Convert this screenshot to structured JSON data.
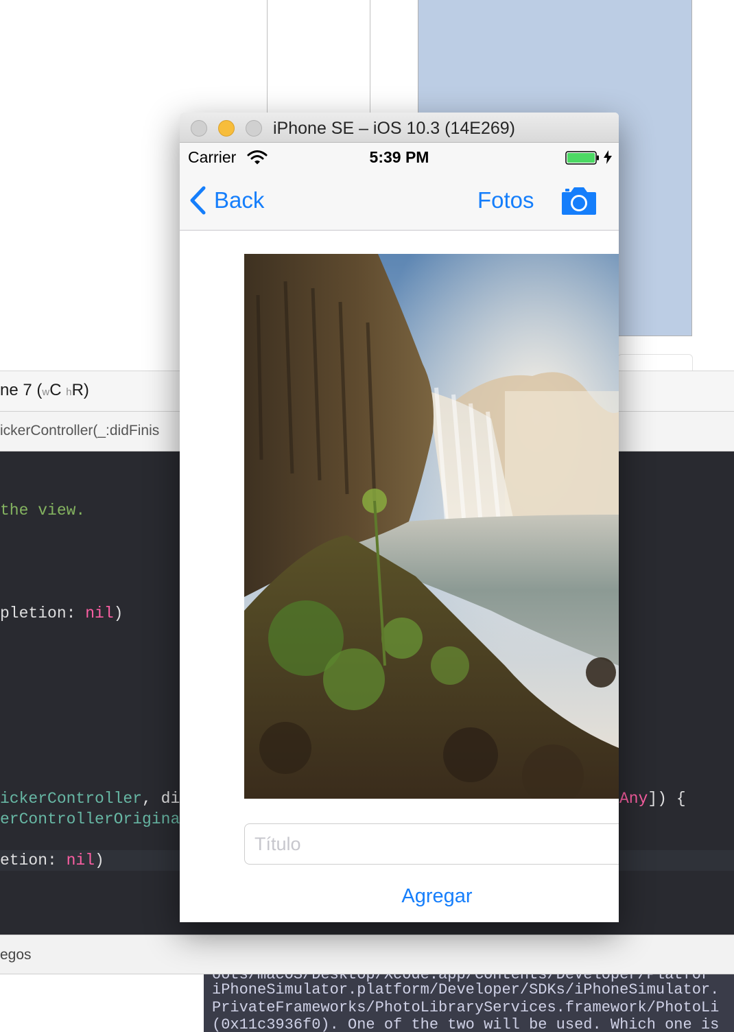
{
  "xcode": {
    "device_label": "ne 7 (",
    "device_size_w": "w",
    "device_size_c": "C",
    "device_size_h": "h",
    "device_size_r": "R)",
    "jump_bar": "ickerController(_:didFinis",
    "code": {
      "line1": "the view.",
      "line2_a": "pletion: ",
      "line2_b": "nil",
      "line2_c": ")",
      "line3_a": "ickerController",
      "line3_b": ", di",
      "line3_right_a": "Any",
      "line3_right_b": "]) {",
      "line4": "erControllerOrigina",
      "line5_a": "etion: ",
      "line5_b": "nil",
      "line5_c": ")"
    },
    "debug_label": "egos",
    "console": [
      "oots/macOS/Desktop/Xcode.app/Contents/Developer/Platfor",
      "iPhoneSimulator.platform/Developer/SDKs/iPhoneSimulator.",
      "PrivateFrameworks/PhotoLibraryServices.framework/PhotoLi",
      "(0x11c3936f0). One of the two will be used. Which one is"
    ]
  },
  "simulator": {
    "window_title": "iPhone SE – iOS 10.3 (14E269)",
    "status": {
      "carrier": "Carrier",
      "time": "5:39 PM"
    },
    "nav": {
      "back_label": "Back",
      "fotos_label": "Fotos",
      "icons": [
        "chevron-left-icon",
        "camera-icon"
      ]
    },
    "form": {
      "title_placeholder": "Título",
      "title_value": "",
      "add_label": "Agregar"
    }
  },
  "colors": {
    "ios_tint": "#157efb",
    "battery_fill": "#4cd964",
    "editor_bg": "#292a30",
    "storyboard_panel": "#bccde4"
  }
}
